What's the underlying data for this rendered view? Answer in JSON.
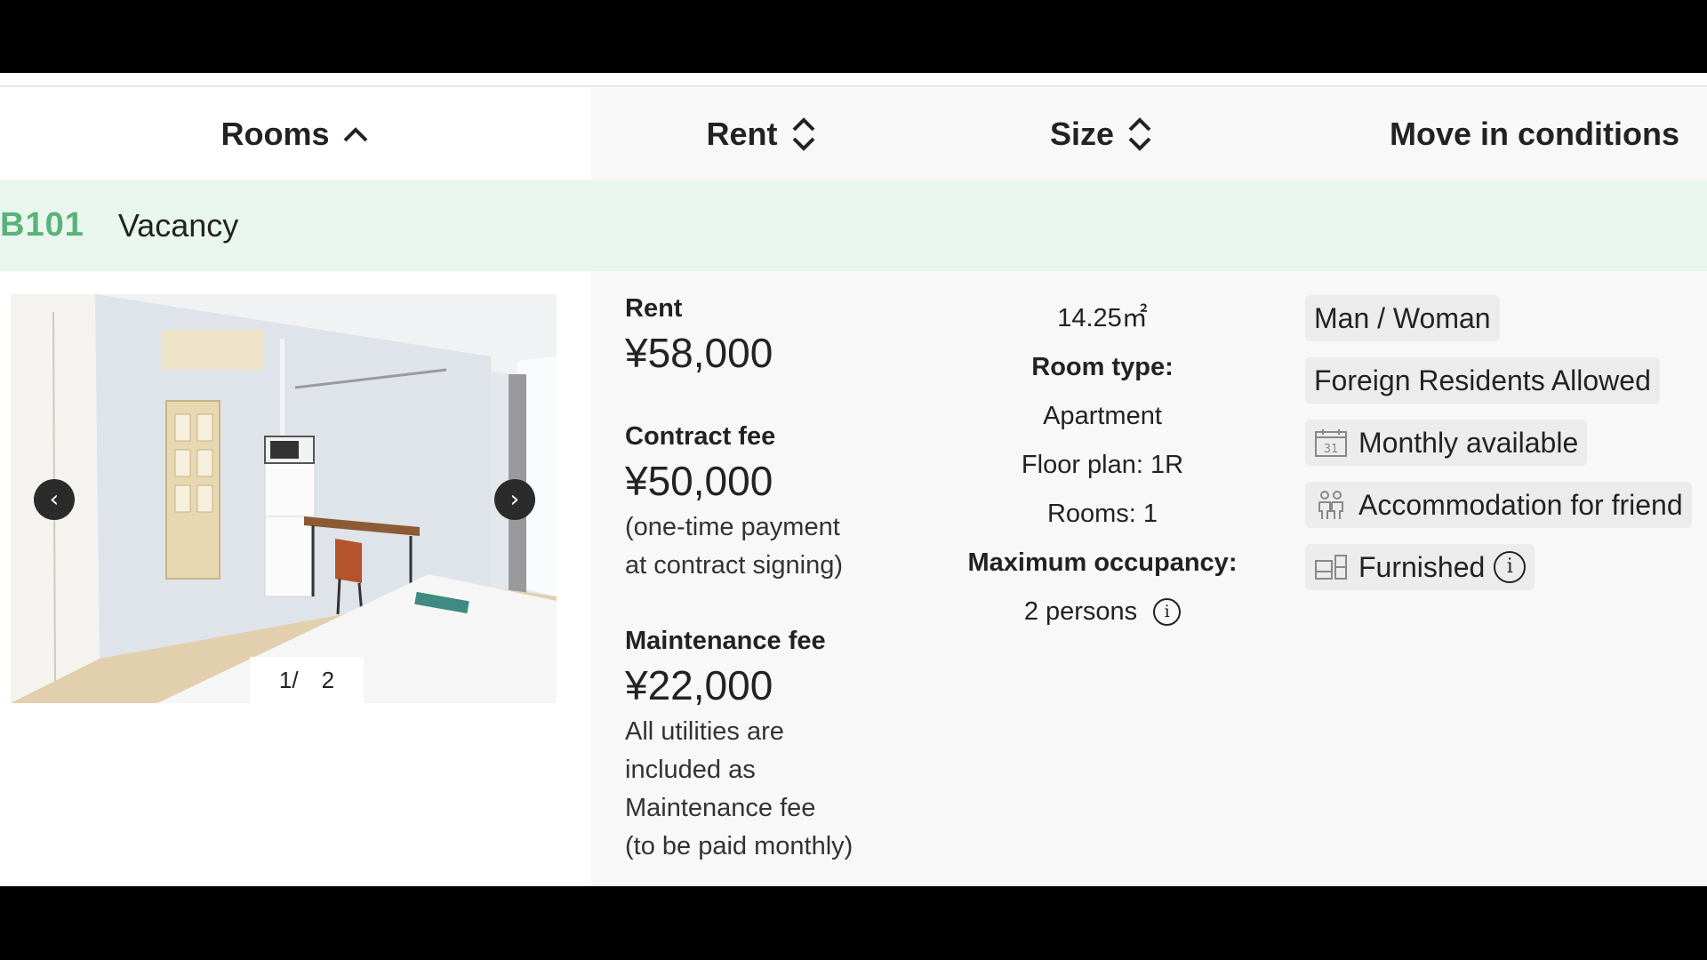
{
  "header": {
    "rooms_label": "Rooms",
    "rent_label": "Rent",
    "size_label": "Size",
    "move_in_label": "Move in conditions"
  },
  "room": {
    "number": "B101",
    "status": "Vacancy",
    "photo": {
      "current": "1",
      "separator": "/",
      "total": "2"
    }
  },
  "rent": {
    "rent_label": "Rent",
    "rent_value": "¥58,000",
    "contract_label": "Contract fee",
    "contract_value": "¥50,000",
    "contract_note_1": "(one-time payment",
    "contract_note_2": "at contract signing)",
    "maintenance_label": "Maintenance fee",
    "maintenance_value": "¥22,000",
    "maintenance_note_1": "All utilities are",
    "maintenance_note_2": "included as",
    "maintenance_note_3": "Maintenance fee",
    "maintenance_note_4": "(to be paid monthly)"
  },
  "size": {
    "area": "14.25㎡",
    "room_type_label": "Room type:",
    "room_type_value": "Apartment",
    "floor_plan": "Floor plan: 1R",
    "rooms": "Rooms: 1",
    "max_occupancy_label": "Maximum occupancy:",
    "max_occupancy_value": "2 persons"
  },
  "conditions": {
    "gender": "Man / Woman",
    "foreign": "Foreign Residents Allowed",
    "monthly": "Monthly available",
    "friends": "Accommodation for friend",
    "furnished": "Furnished"
  },
  "icons": {
    "sort_up": "chevron-up-icon",
    "sort_both": "sort-icon",
    "prev": "chevron-left-icon",
    "next": "chevron-right-icon",
    "info": "info-icon",
    "calendar": "calendar-icon",
    "people": "people-icon",
    "furniture": "furniture-icon"
  },
  "colors": {
    "room_number": "#5ab27a",
    "room_row_bg": "#e9f6ee",
    "tag_bg": "#ececec"
  }
}
